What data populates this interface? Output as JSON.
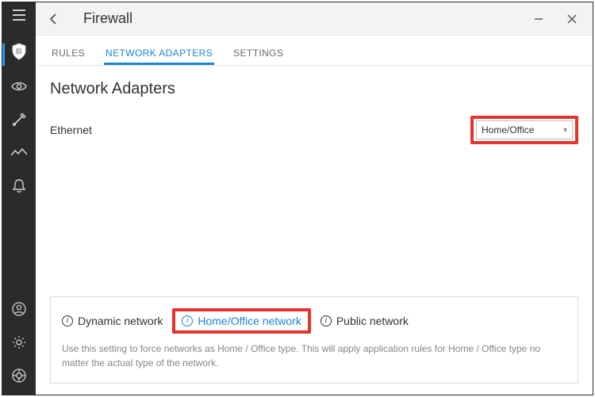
{
  "window": {
    "title": "Firewall"
  },
  "tabs": {
    "rules": "RULES",
    "adapters": "NETWORK ADAPTERS",
    "settings": "SETTINGS"
  },
  "section": {
    "heading": "Network Adapters"
  },
  "adapter": {
    "name": "Ethernet",
    "selected": "Home/Office"
  },
  "options": {
    "dynamic": "Dynamic network",
    "home": "Home/Office network",
    "public": "Public network",
    "description": "Use this setting to force networks as Home / Office type. This will apply application rules for Home / Office type no matter the actual type of the network."
  }
}
